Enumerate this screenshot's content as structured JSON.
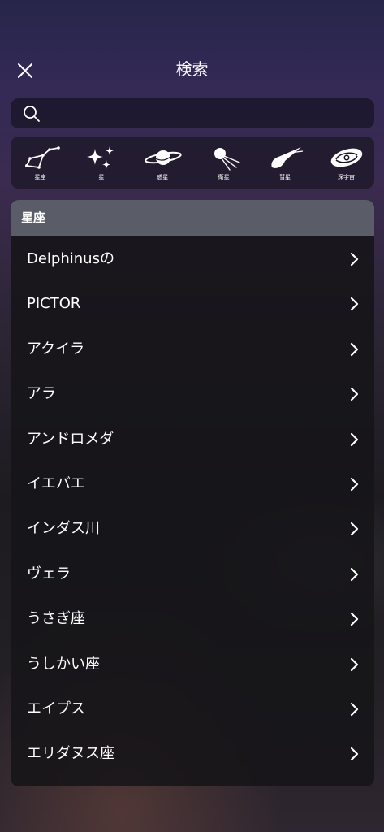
{
  "header": {
    "title": "検索",
    "close_icon": "close-icon"
  },
  "search": {
    "icon": "search-icon",
    "placeholder": "",
    "value": ""
  },
  "categories": [
    {
      "label": "星座",
      "icon": "constellation-icon"
    },
    {
      "label": "星",
      "icon": "stars-icon"
    },
    {
      "label": "惑星",
      "icon": "planet-icon"
    },
    {
      "label": "衛星",
      "icon": "satellite-icon"
    },
    {
      "label": "彗星",
      "icon": "comet-icon"
    },
    {
      "label": "深宇宙",
      "icon": "galaxy-icon"
    }
  ],
  "list": {
    "section_title": "星座",
    "items": [
      {
        "label": "Delphinusの"
      },
      {
        "label": "PICTOR"
      },
      {
        "label": "アクイラ"
      },
      {
        "label": "アラ"
      },
      {
        "label": "アンドロメダ"
      },
      {
        "label": "イエバエ"
      },
      {
        "label": "インダス川"
      },
      {
        "label": "ヴェラ"
      },
      {
        "label": "うさぎ座"
      },
      {
        "label": "うしかい座"
      },
      {
        "label": "エイプス"
      },
      {
        "label": "エリダヌス座"
      }
    ]
  },
  "colors": {
    "section_header_bg": "#5a5d68",
    "panel_bg": "#161518",
    "text": "#ffffff"
  }
}
